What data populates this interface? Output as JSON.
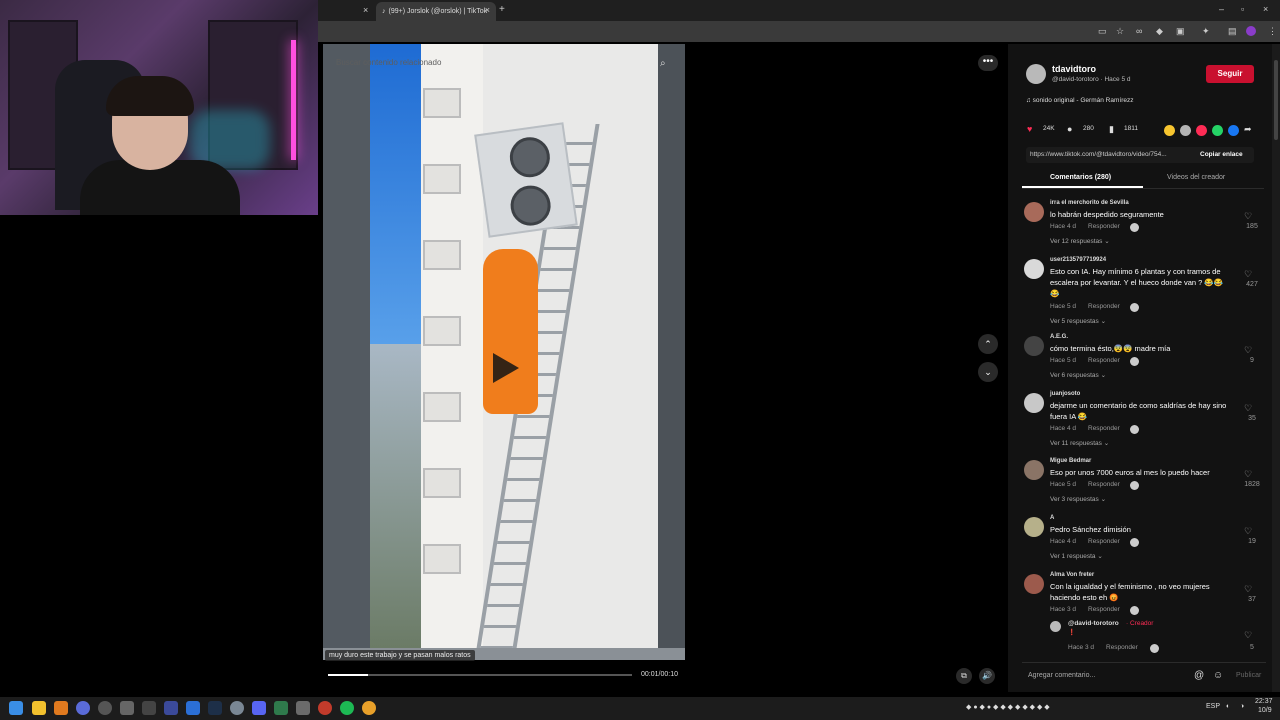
{
  "browser": {
    "tab_title": "(99+) Jorslok (@orslok) | TikTok",
    "new_tab": "+",
    "close": "×",
    "minimize": "–",
    "maximize": "▫",
    "window_close": "×"
  },
  "video": {
    "search_placeholder": "Buscar contenido relacionado",
    "caption": "muy duro este trabajo y se pasan malos ratos",
    "timecode": "00:01/00:10",
    "progress": 0.13,
    "more": "•••",
    "nav_up": "⌃",
    "nav_down": "⌄"
  },
  "creator": {
    "username": "tdavidtoro",
    "handle_time": "@david-torotoro · Hace 5 d",
    "follow": "Seguir",
    "music": "♫  sonido original - Germán Ramírezz",
    "likes": "24K",
    "comments": "280",
    "saves": "1811",
    "link": "https://www.tiktok.com/@tdavidtoro/video/754...",
    "copy_link": "Copiar enlace"
  },
  "tabs": {
    "comments": "Comentarios (280)",
    "videos": "Videos del creador"
  },
  "comments": [
    {
      "user": "irra el merchorito de Sevilla",
      "text": "lo habrán despedido seguramente",
      "time": "Hace 4 d",
      "reply": "Responder",
      "more": "Ver 12 respuestas ⌄",
      "likes": "185",
      "avatar": "#a86a5a"
    },
    {
      "user": "user2135797719924",
      "text": "Esto con IA. Hay mínimo 6 plantas y con tramos de escalera por levantar. Y el hueco donde van ? 😂😂😂",
      "time": "Hace 5 d",
      "reply": "Responder",
      "more": "Ver 5 respuestas ⌄",
      "likes": "427",
      "avatar": "#d9d9d9"
    },
    {
      "user": "A.E.G.",
      "text": "cómo termina ésto,😨😨 madre mía",
      "time": "Hace 5 d",
      "reply": "Responder",
      "more": "Ver 6 respuestas ⌄",
      "likes": "9",
      "avatar": "#444"
    },
    {
      "user": "juanjosoto",
      "text": "dejarme un comentario de como saldrías de hay sino fuera IA 😂",
      "time": "Hace 4 d",
      "reply": "Responder",
      "more": "Ver 11 respuestas ⌄",
      "likes": "35",
      "avatar": "#c8c8c8"
    },
    {
      "user": "Migue Bedmar",
      "text": "Eso por unos 7000 euros al mes lo puedo hacer",
      "time": "Hace 5 d",
      "reply": "Responder",
      "more": "Ver 3 respuestas ⌄",
      "likes": "1828",
      "avatar": "#8a7466"
    },
    {
      "user": "A",
      "text": "Pedro Sánchez dimisión",
      "time": "Hace 4 d",
      "reply": "Responder",
      "more": "Ver 1 respuesta ⌄",
      "likes": "19",
      "avatar": "#b6b08a"
    },
    {
      "user": "Alma Von freter",
      "text": "Con la igualdad y el feminismo , no veo mujeres haciendo esto eh 😡",
      "time": "Hace 3 d",
      "reply": "Responder",
      "more": "",
      "likes": "37",
      "avatar": "#9c5a4c"
    }
  ],
  "reply": {
    "user": "@david-torotoro",
    "badge": " · Creador",
    "text": "❗",
    "time": "Hace 3 d",
    "reply": "Responder",
    "likes": "5"
  },
  "add_comment": {
    "placeholder": "Agregar comentario...",
    "publish": "Publicar"
  },
  "taskbar": {
    "lang": "ESP",
    "time": "22:37",
    "date": "10/9"
  }
}
